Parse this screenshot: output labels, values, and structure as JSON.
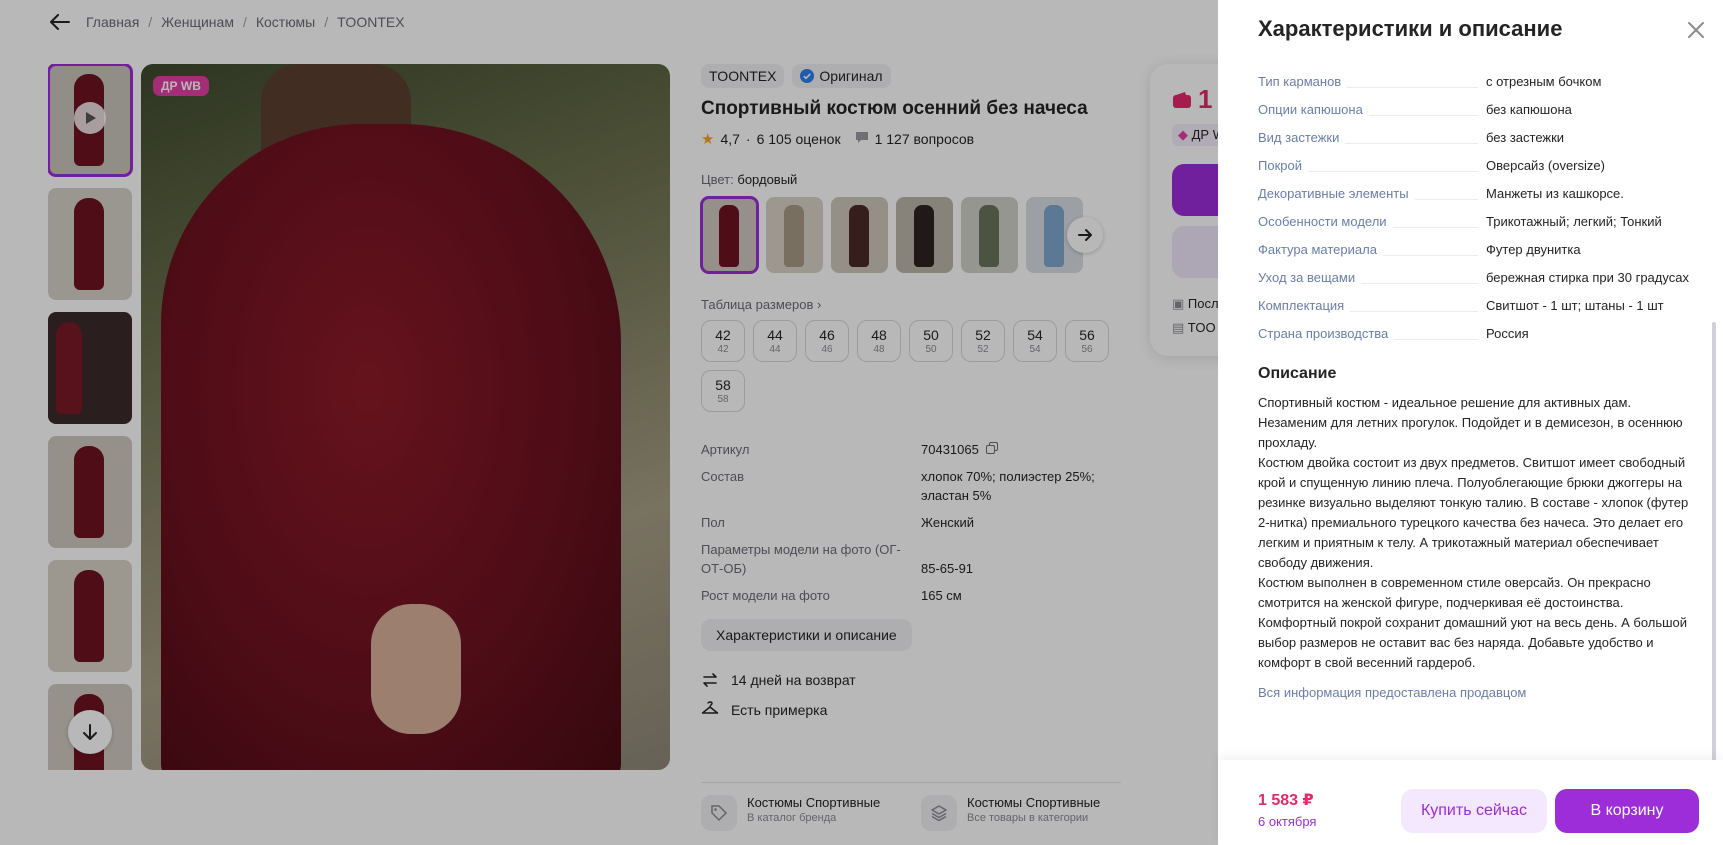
{
  "breadcrumb": [
    "Главная",
    "Женщинам",
    "Костюмы",
    "TOONTEX"
  ],
  "gallery": {
    "badge": "ДР WB",
    "thumbnail_count": 6
  },
  "product": {
    "brand": "TOONTEX",
    "original_label": "Оригинал",
    "title": "Спортивный костюм осенний без начеса",
    "rating": "4,7",
    "reviews": "6 105 оценок",
    "questions": "1 127 вопросов",
    "color_label": "Цвет:",
    "color_value": "бордовый",
    "size_table_label": "Таблица размеров",
    "sizes": [
      {
        "ru": "42",
        "eu": "42"
      },
      {
        "ru": "44",
        "eu": "44"
      },
      {
        "ru": "46",
        "eu": "46"
      },
      {
        "ru": "48",
        "eu": "48"
      },
      {
        "ru": "50",
        "eu": "50"
      },
      {
        "ru": "52",
        "eu": "52"
      },
      {
        "ru": "54",
        "eu": "54"
      },
      {
        "ru": "56",
        "eu": "56"
      },
      {
        "ru": "58",
        "eu": "58"
      }
    ],
    "properties": [
      {
        "key": "Артикул",
        "value": "70431065"
      },
      {
        "key": "Состав",
        "value": "хлопок 70%; полиэстер 25%; эластан 5%"
      },
      {
        "key": "Пол",
        "value": "Женский"
      },
      {
        "key": "Параметры модели на фото (ОГ-ОТ-ОБ)",
        "value": "85-65-91"
      },
      {
        "key": "Рост модели на фото",
        "value": "165 см"
      }
    ],
    "characteristics_button": "Характеристики и описание",
    "perks": [
      "14 дней на возврат",
      "Есть примерка"
    ],
    "categories": [
      {
        "title": "Костюмы Спортивные",
        "subtitle": "В каталог бренда"
      },
      {
        "title": "Костюмы Спортивные",
        "subtitle": "Все товары в категории"
      }
    ]
  },
  "buy_card": {
    "price_fragment": "1",
    "badge_fragment": "ДР W",
    "line1": "Посл",
    "line2": "TOO"
  },
  "panel": {
    "title": "Характеристики и описание",
    "specs": [
      {
        "key": "Тип карманов",
        "value": "с отрезным бочком"
      },
      {
        "key": "Опции капюшона",
        "value": "без капюшона"
      },
      {
        "key": "Вид застежки",
        "value": "без застежки"
      },
      {
        "key": "Покрой",
        "value": "Оверсайз (oversize)"
      },
      {
        "key": "Декоративные элементы",
        "value": "Манжеты из кашкорсе."
      },
      {
        "key": "Особенности модели",
        "value": "Трикотажный; легкий; Тонкий"
      },
      {
        "key": "Фактура материала",
        "value": "Футер двунитка"
      },
      {
        "key": "Уход за вещами",
        "value": "бережная стирка при 30 градусах"
      },
      {
        "key": "Комплектация",
        "value": "Свитшот - 1 шт; штаны - 1 шт"
      },
      {
        "key": "Страна производства",
        "value": "Россия"
      }
    ],
    "description_title": "Описание",
    "description": "Спортивный костюм - идеальное решение для активных дам. Незаменим для летних прогулок. Подойдет и в демисезон, в осеннюю прохладу.\nКостюм двойка состоит из двух предметов. Свитшот имеет свободный крой и спущенную линию плеча. Полуоблегающие брюки джоггеры на резинке визуально выделяют тонкую талию. В составе - хлопок (футер 2-нитка) премиального турецкого качества без начеса. Это делает его легким и приятным к телу. А трикотажный материал обеспечивает свободу движения.\nКостюм выполнен в современном стиле оверсайз. Он прекрасно смотрится на женской фигуре, подчеркивая её достоинства. Комфортный покрой сохранит домашний уют на весь день. А большой выбор размеров не оставит вас без наряда. Добавьте удобство и комфорт в свой весенний гардероб.",
    "seller_note": "Вся информация предоставлена продавцом",
    "footer": {
      "price": "1 583 ₽",
      "date": "6 октября",
      "buy_now": "Купить сейчас",
      "add_to_cart": "В корзину"
    }
  },
  "colors": {
    "accent": "#9c2dd8",
    "price": "#e5296a",
    "badge": "#e53fa6",
    "link": "#6b7ea8",
    "product": "#6d1220"
  }
}
